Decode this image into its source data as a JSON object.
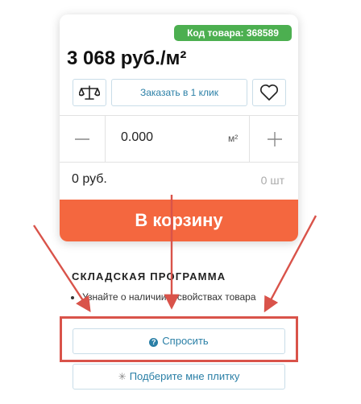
{
  "product": {
    "code_label": "Код товара: 368589",
    "price": "3 068 руб./м²"
  },
  "actions": {
    "compare_icon": "scales-icon",
    "order_one_click": "Заказать в 1 клик",
    "favorite_icon": "heart-icon"
  },
  "quantity": {
    "value": "0.000",
    "unit": "м²",
    "decrement_icon": "minus-icon",
    "increment_icon": "plus-icon"
  },
  "totals": {
    "sum": "0 руб.",
    "count": "0 шт"
  },
  "cart_button": "В корзину",
  "warehouse": {
    "title": "СКЛАДСКАЯ ПРОГРАММА",
    "items": [
      "Узнайте о наличии и свойствах товара"
    ]
  },
  "ask_button": "Спросить",
  "pick_tile_button": "Подберите мне плитку",
  "colors": {
    "badge": "#4caf50",
    "cart": "#f4673f",
    "link": "#2a7fa6",
    "annotation": "#d9534a"
  }
}
